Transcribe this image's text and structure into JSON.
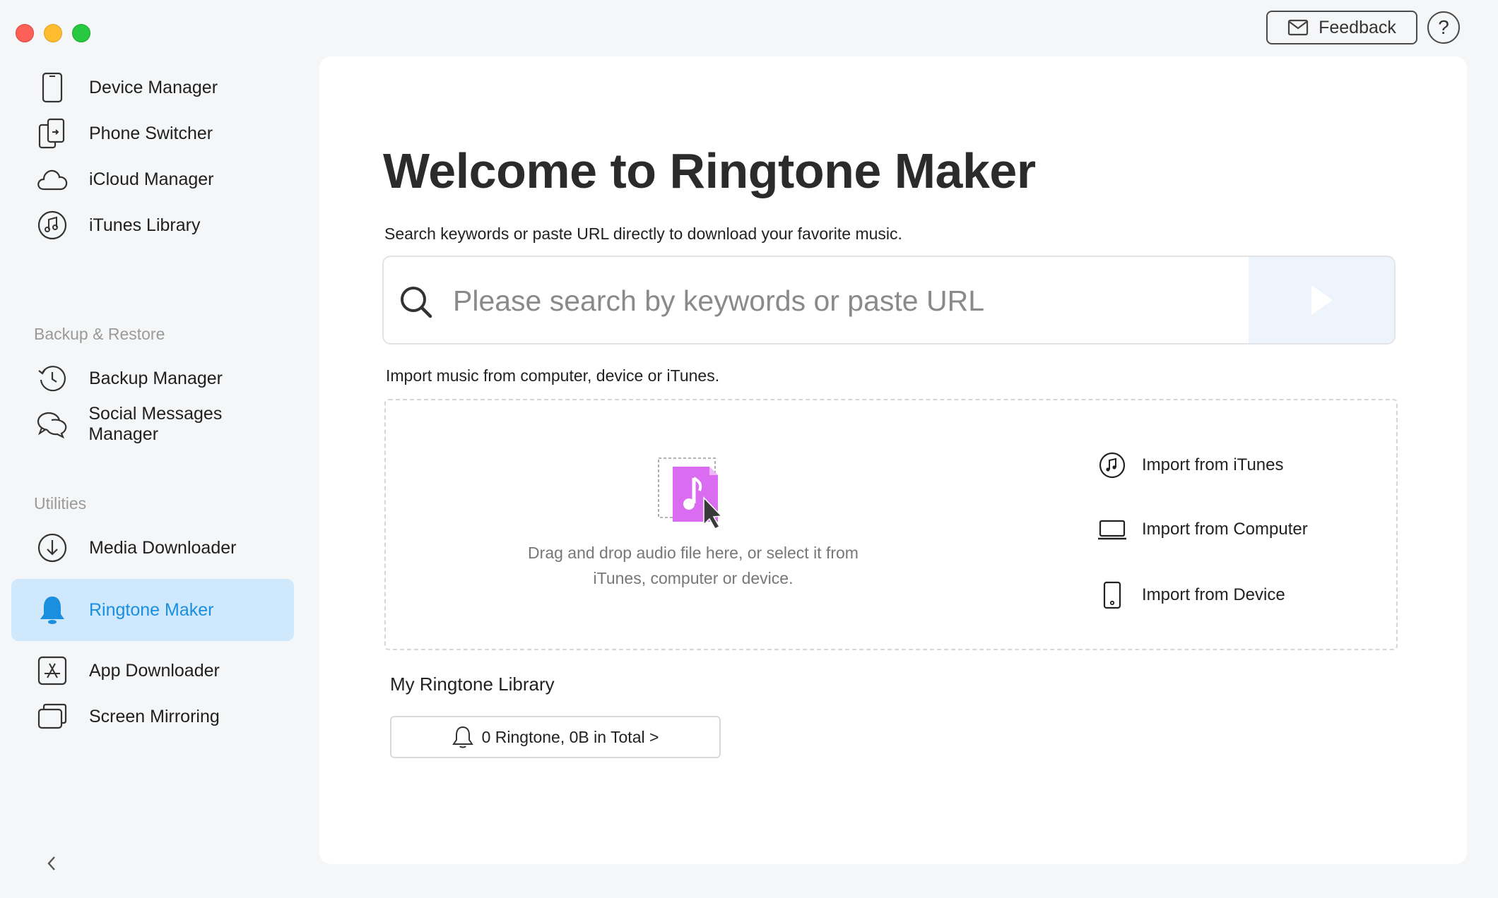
{
  "window": {
    "feedback_label": "Feedback",
    "help_label": "?"
  },
  "sidebar": {
    "items": [
      {
        "label": "Device Manager",
        "icon": "phone-icon"
      },
      {
        "label": "Phone Switcher",
        "icon": "phone-switch-icon"
      },
      {
        "label": "iCloud Manager",
        "icon": "cloud-icon"
      },
      {
        "label": "iTunes Library",
        "icon": "music-note-icon"
      },
      {
        "label": "Backup Manager",
        "icon": "history-icon"
      },
      {
        "label": "Social Messages Manager",
        "icon": "chat-bubbles-icon"
      },
      {
        "label": "Media Downloader",
        "icon": "download-icon"
      },
      {
        "label": "Ringtone Maker",
        "icon": "bell-icon",
        "active": true
      },
      {
        "label": "App Downloader",
        "icon": "app-store-icon"
      },
      {
        "label": "Screen Mirroring",
        "icon": "screen-mirror-icon"
      }
    ],
    "sections": {
      "backup": "Backup & Restore",
      "utilities": "Utilities"
    }
  },
  "main": {
    "title": "Welcome to Ringtone Maker",
    "subtitle": "Search keywords or paste URL directly to download your favorite music.",
    "search": {
      "placeholder": "Please search by keywords or paste URL",
      "value": ""
    },
    "import_label": "Import music from computer, device or iTunes.",
    "drop_text_line1": "Drag and drop audio file here, or select it from",
    "drop_text_line2": "iTunes, computer or device.",
    "import_options": [
      {
        "label": "Import from iTunes",
        "icon": "music-note-circle-icon"
      },
      {
        "label": "Import from Computer",
        "icon": "laptop-icon"
      },
      {
        "label": "Import from Device",
        "icon": "tablet-icon"
      }
    ],
    "library": {
      "title": "My Ringtone Library",
      "summary": "0 Ringtone,  0B in Total >"
    }
  },
  "colors": {
    "accent": "#1a8fe0",
    "active_bg": "#cfe8fb",
    "illustration": "#d96cf0"
  }
}
